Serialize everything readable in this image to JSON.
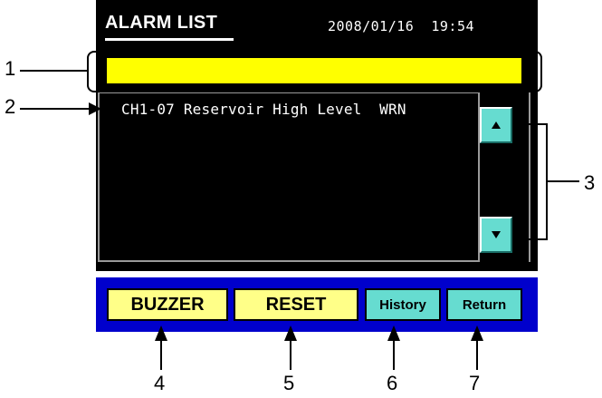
{
  "screen": {
    "title": "ALARM LIST",
    "datetime": "2008/01/16  19:54",
    "active_alarm": "",
    "alarms": [
      "CH1-07 Reservoir High Level  WRN"
    ]
  },
  "buttons": {
    "buzzer": "BUZZER",
    "reset": "RESET",
    "history": "History",
    "return": "Return",
    "scroll_up": "up-arrow-icon",
    "scroll_down": "down-arrow-icon"
  },
  "callouts": [
    "1",
    "2",
    "3",
    "4",
    "5",
    "6",
    "7"
  ],
  "colors": {
    "screen_bg": "#000000",
    "active_bar": "#ffff00",
    "button_bar": "#0000cc",
    "yellow_button": "#ffff88",
    "cyan_button": "#66dcd0",
    "text": "#ffffff"
  }
}
